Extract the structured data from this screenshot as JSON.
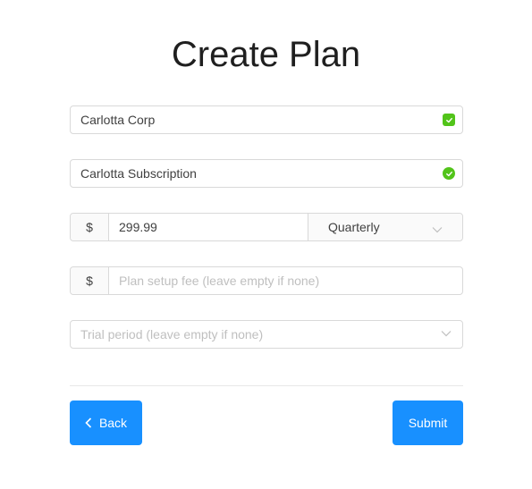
{
  "title": "Create Plan",
  "fields": {
    "company": {
      "value": "Carlotta Corp",
      "valid": true
    },
    "subscription": {
      "value": "Carlotta Subscription",
      "valid": true
    },
    "price": {
      "currency_symbol": "$",
      "value": "299.99",
      "period": "Quarterly"
    },
    "setup_fee": {
      "currency_symbol": "$",
      "placeholder": "Plan setup fee (leave empty if none)"
    },
    "trial": {
      "placeholder": "Trial period (leave empty if none)"
    }
  },
  "actions": {
    "back_label": "Back",
    "submit_label": "Submit"
  },
  "colors": {
    "primary": "#1890ff",
    "success": "#52c41a",
    "border": "#d9d9d9",
    "placeholder": "#bfbfbf"
  },
  "icons": {
    "valid": "check-circle-icon",
    "dropdown": "chevron-down-icon",
    "back": "chevron-left-icon"
  }
}
